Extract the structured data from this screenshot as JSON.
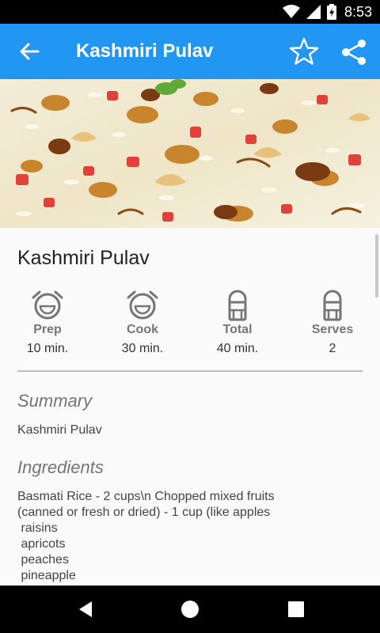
{
  "status_bar": {
    "time": "8:53"
  },
  "app_bar": {
    "title": "Kashmiri Pulav",
    "accent": "#2196f3"
  },
  "recipe": {
    "name": "Kashmiri Pulav",
    "stats": [
      {
        "label": "Prep",
        "value": "10 min.",
        "icon": "stopwatch-icon"
      },
      {
        "label": "Cook",
        "value": "30 min.",
        "icon": "stopwatch-icon"
      },
      {
        "label": "Total",
        "value": "40 min.",
        "icon": "chef-icon"
      },
      {
        "label": "Serves",
        "value": "2",
        "icon": "chef-icon"
      }
    ],
    "summary_heading": "Summary",
    "summary": "Kashmiri Pulav",
    "ingredients_heading": "Ingredients",
    "ingredients": "Basmati Rice - 2 cups\\n Chopped mixed fruits\n(canned or fresh or dried) - 1 cup (like apples\n raisins\n apricots\n peaches\n pineapple"
  }
}
